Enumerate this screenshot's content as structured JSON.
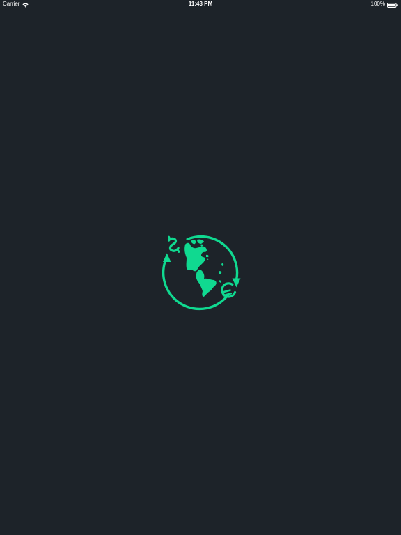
{
  "status_bar": {
    "carrier": "Carrier",
    "wifi_icon": "wifi-icon",
    "time": "11:43 PM",
    "battery_percent": "100%",
    "battery_icon": "battery-full-icon"
  },
  "splash": {
    "logo_icon": "globe-currency-exchange-icon",
    "accent_color": "#10d990",
    "background_color": "#1d2329"
  }
}
